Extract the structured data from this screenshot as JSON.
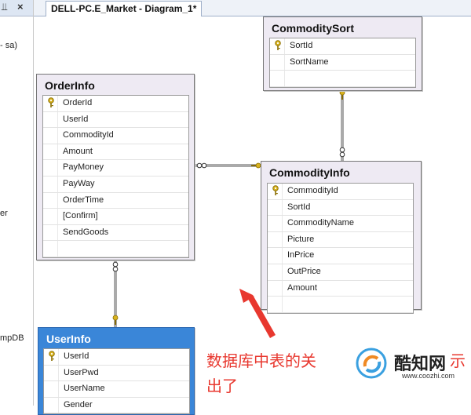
{
  "left_panel": {
    "pin_glyph": "⫫",
    "close_glyph": "×",
    "fragments": [
      "- sa)",
      "er",
      "mpDB"
    ]
  },
  "tab": {
    "title": "DELL-PC.E_Market - Diagram_1*"
  },
  "tables": {
    "commodity_sort": {
      "title": "CommoditySort",
      "columns": [
        {
          "name": "SortId",
          "key": true
        },
        {
          "name": "SortName",
          "key": false
        },
        {
          "name": "",
          "key": false
        }
      ]
    },
    "order_info": {
      "title": "OrderInfo",
      "columns": [
        {
          "name": "OrderId",
          "key": true
        },
        {
          "name": "UserId",
          "key": false
        },
        {
          "name": "CommodityId",
          "key": false
        },
        {
          "name": "Amount",
          "key": false
        },
        {
          "name": "PayMoney",
          "key": false
        },
        {
          "name": "PayWay",
          "key": false
        },
        {
          "name": "OrderTime",
          "key": false
        },
        {
          "name": "[Confirm]",
          "key": false
        },
        {
          "name": "SendGoods",
          "key": false
        },
        {
          "name": "",
          "key": false
        }
      ]
    },
    "commodity_info": {
      "title": "CommodityInfo",
      "columns": [
        {
          "name": "CommodityId",
          "key": true
        },
        {
          "name": "SortId",
          "key": false
        },
        {
          "name": "CommodityName",
          "key": false
        },
        {
          "name": "Picture",
          "key": false
        },
        {
          "name": "InPrice",
          "key": false
        },
        {
          "name": "OutPrice",
          "key": false
        },
        {
          "name": "Amount",
          "key": false
        },
        {
          "name": "",
          "key": false
        }
      ]
    },
    "user_info": {
      "title": "UserInfo",
      "columns": [
        {
          "name": "UserId",
          "key": true
        },
        {
          "name": "UserPwd",
          "key": false
        },
        {
          "name": "UserName",
          "key": false
        },
        {
          "name": "Gender",
          "key": false
        }
      ]
    }
  },
  "annotation": {
    "line1_a": "数据库中表的关",
    "line1_b": "示",
    "line2": "出了"
  },
  "watermark": {
    "name": "酷知网",
    "url": "www.coozhi.com"
  },
  "colors": {
    "accent_selected": "#3a86d8",
    "annotation_red": "#e8382f",
    "key_gold": "#d8b21e",
    "relation_line": "#555555"
  }
}
